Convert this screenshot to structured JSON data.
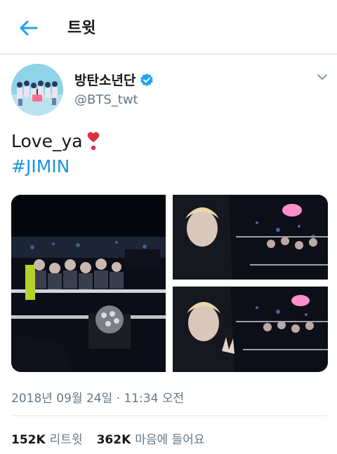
{
  "header": {
    "title": "트윗",
    "back_icon": "arrow-left-icon",
    "accent": "#1da1f2"
  },
  "author": {
    "name": "방탄소년단",
    "handle": "@BTS_twt",
    "verified": true
  },
  "tweet": {
    "line1": "Love_ya",
    "emoji": "heavy-heart-exclamation-icon",
    "hashtag": "#JIMIN",
    "hashtag_color": "#1b95e0",
    "photos": [
      "concert-crowd-photo",
      "selfie-with-crowd-photo-1",
      "selfie-with-crowd-photo-2"
    ]
  },
  "meta": {
    "timestamp": "2018년 09월 24일 · 11:34 오전"
  },
  "stats": {
    "retweets_count": "152K",
    "retweets_label": "리트윗",
    "likes_count": "362K",
    "likes_label": "마음에 들어요"
  }
}
